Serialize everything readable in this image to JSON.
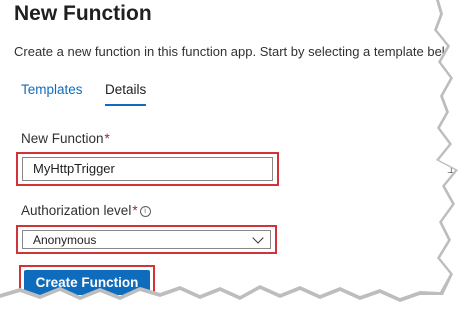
{
  "page": {
    "title": "New Function",
    "subtitle": "Create a new function in this function app. Start by selecting a template belo"
  },
  "tabs": [
    {
      "label": "Templates",
      "active": false
    },
    {
      "label": "Details",
      "active": true
    }
  ],
  "form": {
    "function_name": {
      "label": "New Function",
      "required_mark": "*",
      "value": "MyHttpTrigger"
    },
    "authorization_level": {
      "label": "Authorization level",
      "required_mark": "*",
      "info_glyph": "i",
      "selected": "Anonymous"
    },
    "submit_label": "Create Function"
  },
  "colors": {
    "accent": "#0f6cbd",
    "highlight": "#d13438",
    "required": "#a4262c"
  },
  "icons": {
    "info": "info-icon",
    "dropdown": "chevron-down-icon",
    "cursor": "text-cursor-icon"
  }
}
